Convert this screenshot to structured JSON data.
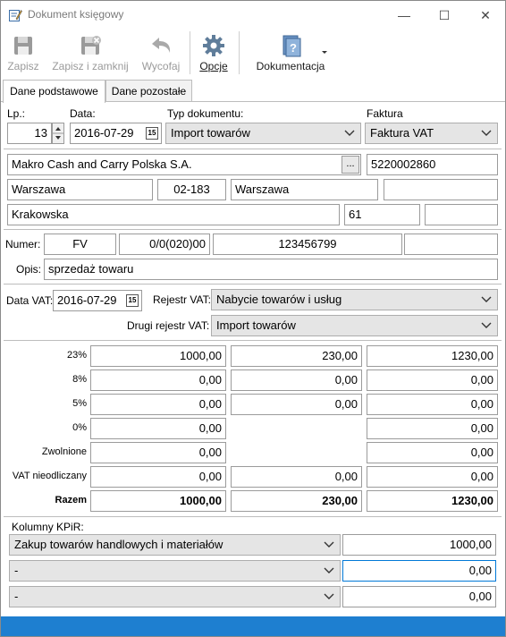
{
  "window": {
    "title": "Dokument księgowy",
    "minimize": "—",
    "maximize": "☐",
    "close": "✕"
  },
  "toolbar": {
    "save": {
      "label": "Zapisz",
      "icon": "save-icon"
    },
    "save_close": {
      "label": "Zapisz i zamknij",
      "icon": "save-close-icon"
    },
    "undo": {
      "label": "Wycofaj",
      "icon": "undo-icon"
    },
    "options": {
      "label": "Opcje",
      "icon": "gear-icon"
    },
    "docs": {
      "label": "Dokumentacja",
      "icon": "help-document-icon"
    }
  },
  "tabs": [
    {
      "label": "Dane podstawowe"
    },
    {
      "label": "Dane pozostałe"
    }
  ],
  "header": {
    "lp_label": "Lp.:",
    "lp_value": "13",
    "date_label": "Data:",
    "date_value": "2016-07-29",
    "doc_type_label": "Typ dokumentu:",
    "doc_type_value": "Import towarów",
    "invoice_label": "Faktura",
    "invoice_value": "Faktura VAT"
  },
  "contractor": {
    "name": "Makro Cash and Carry Polska S.A.",
    "picker": "...",
    "nip": "5220002860",
    "city": "Warszawa",
    "postal": "02-183",
    "post_office": "Warszawa",
    "extra1": "",
    "street": "Krakowska",
    "number": "61",
    "apt": ""
  },
  "document": {
    "number_label": "Numer:",
    "prefix": "FV",
    "middle": "0/0(020)00",
    "number": "123456799",
    "suffix": "",
    "desc_label": "Opis:",
    "desc": "sprzedaż towaru"
  },
  "vat": {
    "date_label": "Data VAT:",
    "date_value": "2016-07-29",
    "register_label": "Rejestr VAT:",
    "register_value": "Nabycie towarów i usług",
    "register2_label": "Drugi rejestr VAT:",
    "register2_value": "Import towarów"
  },
  "rates": [
    {
      "label": "23%",
      "net": "1000,00",
      "vat": "230,00",
      "gross": "1230,00"
    },
    {
      "label": "8%",
      "net": "0,00",
      "vat": "0,00",
      "gross": "0,00"
    },
    {
      "label": "5%",
      "net": "0,00",
      "vat": "0,00",
      "gross": "0,00"
    },
    {
      "label": "0%",
      "net": "0,00",
      "vat": "",
      "gross": "0,00"
    },
    {
      "label": "Zwolnione",
      "net": "0,00",
      "vat": "",
      "gross": "0,00"
    },
    {
      "label": "VAT nieodliczany",
      "net": "0,00",
      "vat": "0,00",
      "gross": "0,00"
    },
    {
      "label": "Razem",
      "net": "1000,00",
      "vat": "230,00",
      "gross": "1230,00"
    }
  ],
  "kpir": {
    "label": "Kolumny KPiR:",
    "rows": [
      {
        "column": "Zakup towarów handlowych i materiałów",
        "amount": "1000,00"
      },
      {
        "column": "-",
        "amount": "0,00"
      },
      {
        "column": "-",
        "amount": "0,00"
      }
    ]
  },
  "colors": {
    "accent": "#1e7fd0",
    "focus": "#0078d7"
  }
}
